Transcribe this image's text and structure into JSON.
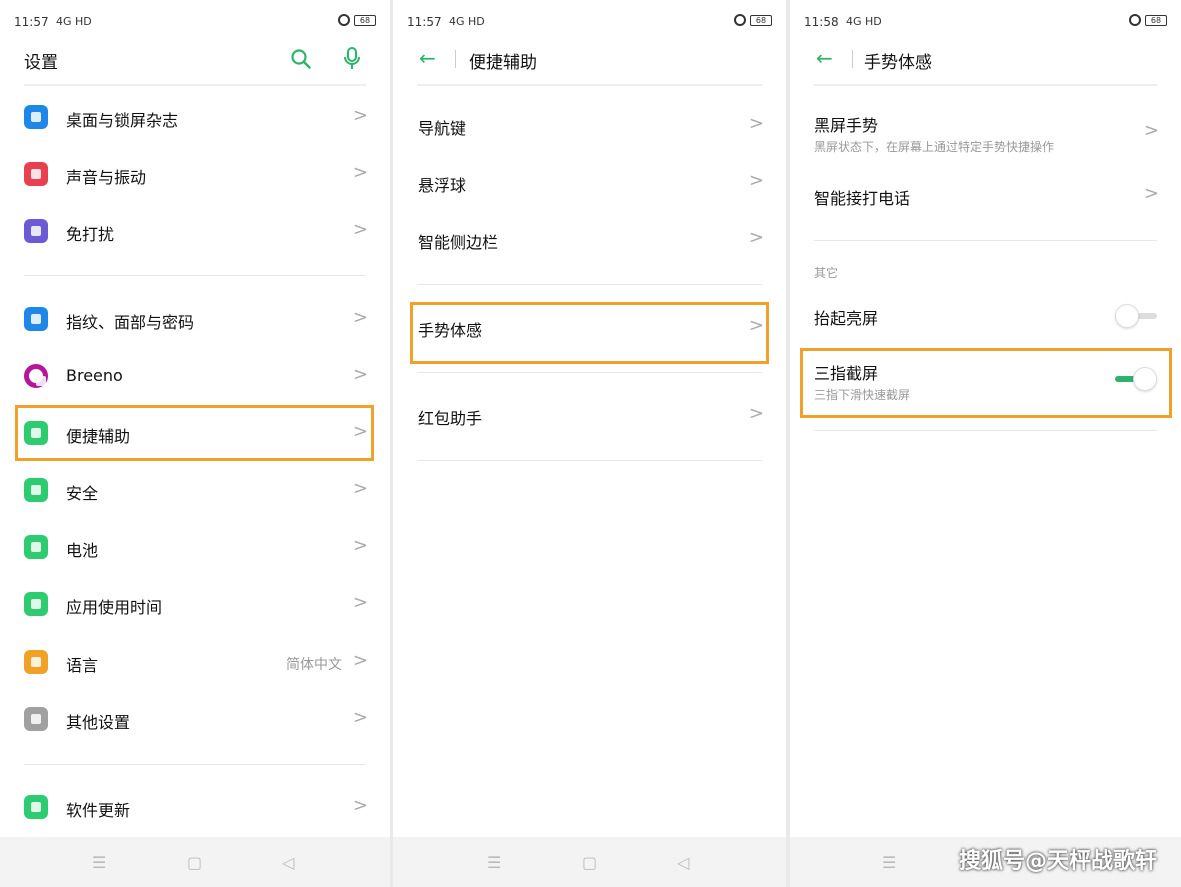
{
  "panel1": {
    "status": {
      "time": "11:57",
      "network": "4G HD",
      "battery": "68"
    },
    "title": "设置",
    "items": [
      {
        "label": "桌面与锁屏杂志",
        "icon": "wallpaper-icon",
        "color": "#1f87e8"
      },
      {
        "label": "声音与振动",
        "icon": "speaker-icon",
        "color": "#e8404f"
      },
      {
        "label": "免打扰",
        "icon": "moon-icon",
        "color": "#6b59d6"
      },
      {
        "label": "指纹、面部与密码",
        "icon": "fingerprint-icon",
        "color": "#1f87e8"
      },
      {
        "label": "Breeno",
        "icon": "breeno-icon",
        "color": "#b8169a"
      },
      {
        "label": "便捷辅助",
        "icon": "assist-icon",
        "color": "#2ecc71"
      },
      {
        "label": "安全",
        "icon": "shield-icon",
        "color": "#2ecc71"
      },
      {
        "label": "电池",
        "icon": "battery-icon",
        "color": "#2ecc71"
      },
      {
        "label": "应用使用时间",
        "icon": "app-usage-icon",
        "color": "#2ecc71"
      },
      {
        "label": "语言",
        "icon": "language-icon",
        "color": "#f2a127",
        "value": "简体中文"
      },
      {
        "label": "其他设置",
        "icon": "other-settings-icon",
        "color": "#a0a0a0"
      },
      {
        "label": "软件更新",
        "icon": "update-icon",
        "color": "#2ecc71"
      }
    ]
  },
  "panel2": {
    "status": {
      "time": "11:57",
      "network": "4G HD",
      "battery": "68"
    },
    "title": "便捷辅助",
    "items": [
      "导航键",
      "悬浮球",
      "智能侧边栏",
      "手势体感",
      "红包助手"
    ]
  },
  "panel3": {
    "status": {
      "time": "11:58",
      "network": "4G HD",
      "battery": "68"
    },
    "title": "手势体感",
    "black_screen": {
      "label": "黑屏手势",
      "sub": "黑屏状态下，在屏幕上通过特定手势快捷操作"
    },
    "smart_call": {
      "label": "智能接打电话"
    },
    "section": "其它",
    "raise_wake": {
      "label": "抬起亮屏",
      "on": false
    },
    "three_finger": {
      "label": "三指截屏",
      "sub": "三指下滑快速截屏",
      "on": true
    }
  },
  "nav": {
    "menu": "☰",
    "home": "▢",
    "back": "◁"
  },
  "watermark": "搜狐号@天枰战歌轩",
  "colors": {
    "accent": "#2db36b",
    "highlight": "#f0a12c"
  }
}
